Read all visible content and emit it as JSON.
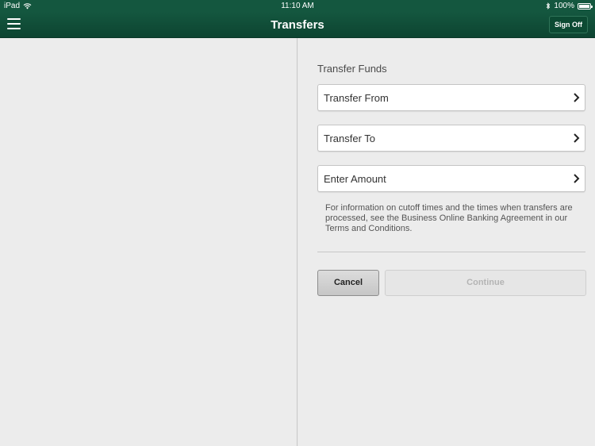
{
  "status_bar": {
    "device": "iPad",
    "time": "11:10 AM",
    "battery_text": "100%"
  },
  "nav": {
    "title": "Transfers",
    "sign_off_label": "Sign Off"
  },
  "form": {
    "section_title": "Transfer Funds",
    "fields": [
      {
        "label": "Transfer From"
      },
      {
        "label": "Transfer To"
      },
      {
        "label": "Enter Amount"
      }
    ],
    "info_text": "For information on cutoff times and the times when transfers are processed, see the Business Online Banking Agreement in our Terms and Conditions.",
    "cancel_label": "Cancel",
    "continue_label": "Continue"
  },
  "colors": {
    "brand_green": "#14573f",
    "background": "#ececec"
  }
}
